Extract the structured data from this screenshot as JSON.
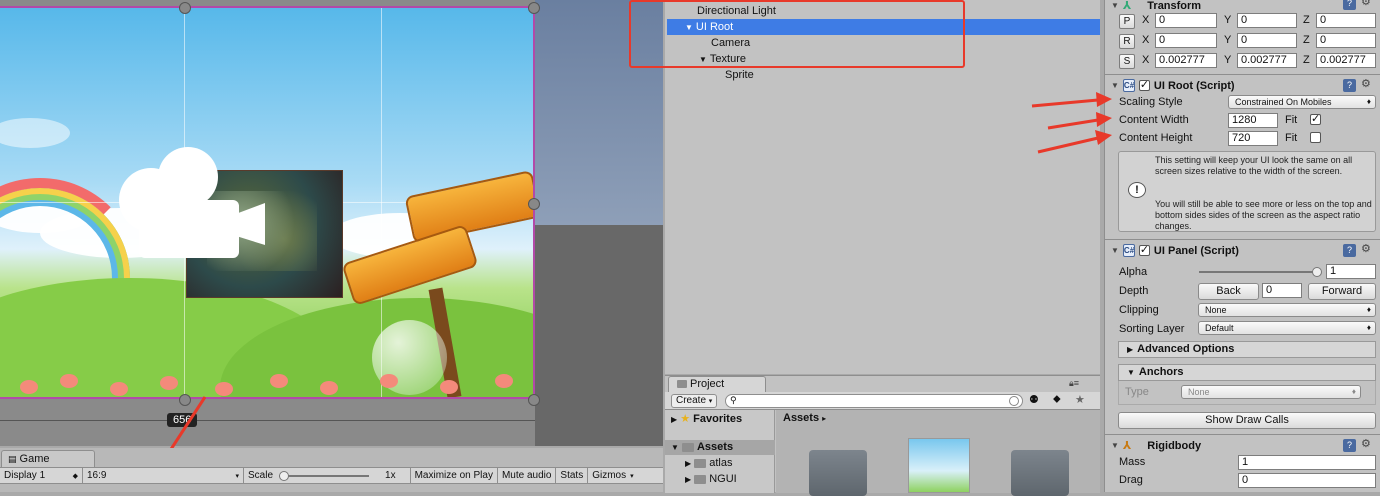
{
  "scene": {
    "size_label": "656"
  },
  "game": {
    "tab_label": "Game",
    "display": "Display 1",
    "aspect": "16:9",
    "scale_label": "Scale",
    "scale_value": "1x",
    "maximize": "Maximize on Play",
    "mute": "Mute audio",
    "stats": "Stats",
    "gizmos": "Gizmos"
  },
  "hierarchy": {
    "items": [
      {
        "label": "Directional Light"
      },
      {
        "label": "UI Root"
      },
      {
        "label": "Camera"
      },
      {
        "label": "Texture"
      },
      {
        "label": "Sprite"
      }
    ]
  },
  "project": {
    "tab_label": "Project",
    "create_label": "Create",
    "favorites_label": "Favorites",
    "assets_label": "Assets",
    "breadcrumb": "Assets",
    "folders": [
      {
        "label": "atlas"
      },
      {
        "label": "NGUI"
      }
    ]
  },
  "inspector": {
    "transform": {
      "title": "Transform",
      "position": {
        "btn": "P",
        "x": "0",
        "y": "0",
        "z": "0"
      },
      "rotation": {
        "btn": "R",
        "x": "0",
        "y": "0",
        "z": "0"
      },
      "scale": {
        "btn": "S",
        "x": "0.002777",
        "y": "0.002777",
        "z": "0.002777"
      },
      "x_label": "X",
      "y_label": "Y",
      "z_label": "Z"
    },
    "ui_root": {
      "title": "UI Root (Script)",
      "scaling_style_label": "Scaling Style",
      "scaling_style_value": "Constrained On Mobiles",
      "content_width_label": "Content Width",
      "content_width_value": "1280",
      "content_height_label": "Content Height",
      "content_height_value": "720",
      "fit_label": "Fit",
      "fit_width_checked": true,
      "fit_height_checked": false,
      "help_text_1": "This setting will keep your UI look the same on all screen sizes relative to the width of the screen.",
      "help_text_2": "You will still be able to see more or less on the top and bottom sides sides of the screen as the aspect ratio changes."
    },
    "ui_panel": {
      "title": "UI Panel (Script)",
      "alpha_label": "Alpha",
      "alpha_value": "1",
      "alpha_fraction": 1,
      "depth_label": "Depth",
      "back_label": "Back",
      "depth_value": "0",
      "forward_label": "Forward",
      "clipping_label": "Clipping",
      "clipping_value": "None",
      "sorting_label": "Sorting Layer",
      "sorting_value": "Default",
      "advanced_label": "Advanced Options",
      "anchors_label": "Anchors",
      "type_label": "Type",
      "type_value": "None",
      "draw_calls_label": "Show Draw Calls"
    },
    "rigidbody": {
      "title": "Rigidbody",
      "mass_label": "Mass",
      "mass_value": "1",
      "drag_label": "Drag",
      "drag_value": "0"
    }
  },
  "colors": {
    "selection": "#3e7ce5",
    "annotation_red": "#e8392a",
    "canvas_border": "#b24aa8"
  }
}
